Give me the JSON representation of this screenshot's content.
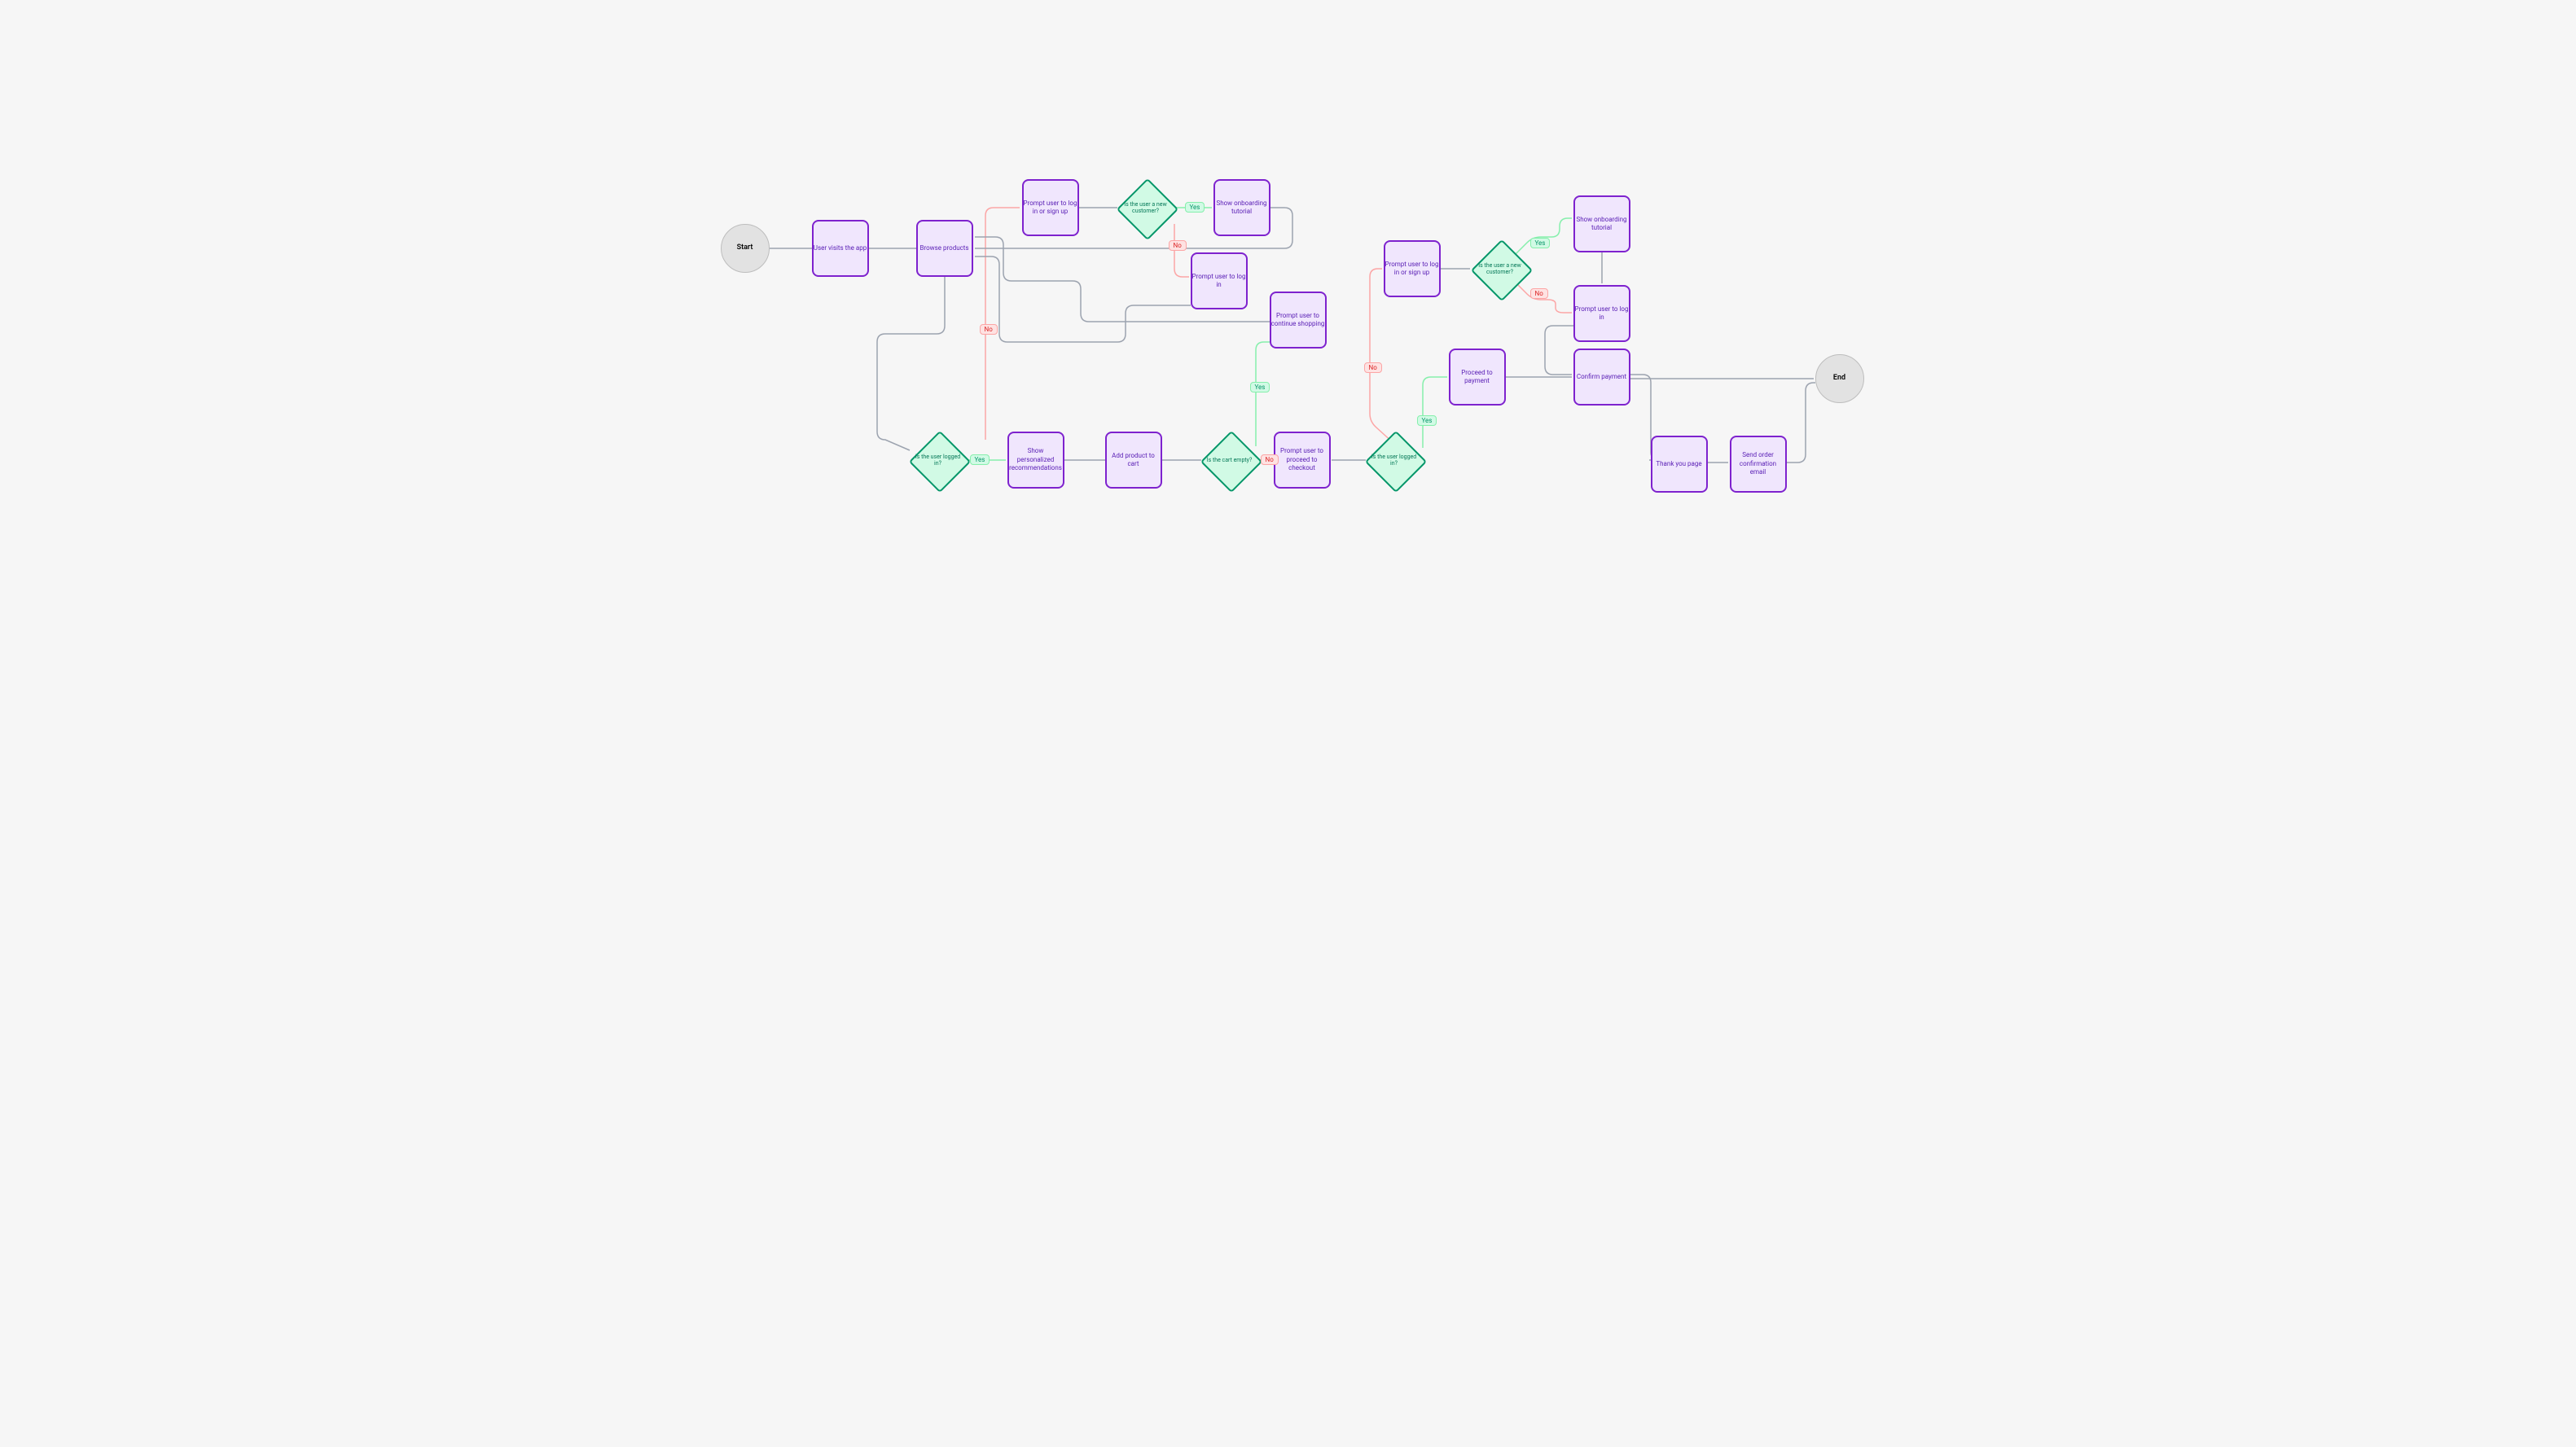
{
  "nodes": {
    "start": "Start",
    "end": "End",
    "visit": "User visits the app",
    "browse": "Browse products",
    "prompt_login_top": "Prompt user to log in or sign up",
    "onboard_top": "Show onboarding tutorial",
    "login_top": "Prompt user to log in",
    "continue_shopping": "Prompt user to continue shopping",
    "recs": "Show personalized recommendations",
    "add_cart": "Add product to cart",
    "checkout": "Prompt user to proceed to checkout",
    "prompt_login_right": "Prompt user to log in or sign up",
    "onboard_right": "Show onboarding tutorial",
    "login_right": "Prompt user to log in",
    "payment": "Proceed to payment",
    "confirm": "Confirm payment",
    "thank_you": "Thank you page",
    "email": "Send order confirmation email"
  },
  "decisions": {
    "logged_in_left": "Is the user logged in?",
    "new_customer_top": "Is the user a new customer?",
    "cart_empty": "Is the cart empty?",
    "logged_in_right": "Is the user logged in?",
    "new_customer_right": "Is the user a new customer?"
  },
  "labels": {
    "yes": "Yes",
    "no": "No"
  }
}
